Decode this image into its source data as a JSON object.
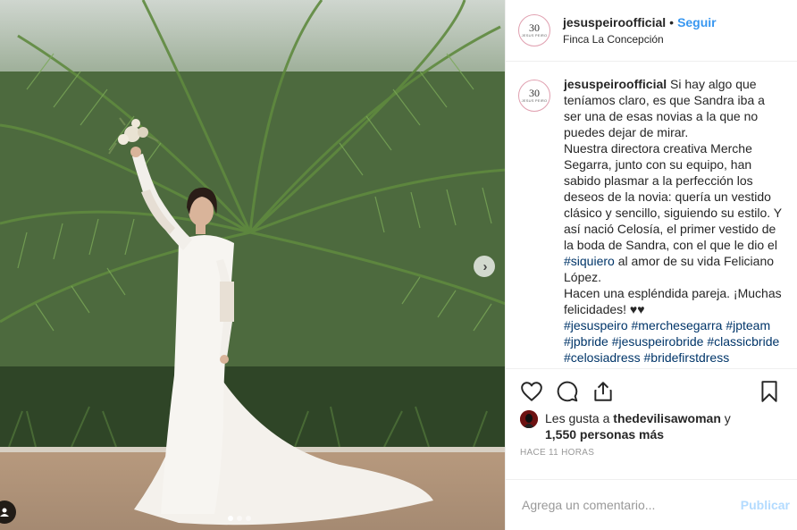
{
  "post": {
    "username": "jesuspeirooffical_placeholder",
    "follow_label": "Seguir",
    "location": "Finca La Concepción",
    "avatar_number": "30",
    "avatar_text": "JESUS PEIRO"
  },
  "caption": {
    "username": "jesuspeirooffical_placeholder",
    "text_1": "Si hay algo que teníamos claro, es que Sandra iba a ser una de esas novias a la que no puedes dejar de mirar.",
    "text_2": "Nuestra directora creativa Merche Segarra, junto con su equipo, han sabido plasmar a la perfección los deseos de la novia: quería un vestido clásico y sencillo, siguiendo su estilo. Y así nació Celosía, el primer vestido de la boda de Sandra, con el que le dio el",
    "hashtag_siquiero": "#siquiero",
    "text_3": "al amor de su vida Feliciano López.",
    "text_4": "Hacen una espléndida pareja. ¡Muchas felicidades! ♥♥",
    "hashtags": [
      "#jesuspeiro",
      "#merchesegarra",
      "#jpteam",
      "#jpbride",
      "#jesuspeirobride",
      "#classicbride",
      "#celosiadress",
      "#bridefirstdress"
    ]
  },
  "likes": {
    "prefix": "Les gusta a",
    "user": "thedevilisawoman",
    "joiner": "y",
    "count": "1,550 personas más"
  },
  "timestamp": "HACE 11 HORAS",
  "comment": {
    "placeholder": "Agrega un comentario...",
    "publish_label": "Publicar"
  },
  "colors": {
    "link_blue": "#3897f0",
    "hashtag": "#003569",
    "publish_disabled": "#b3dbff"
  },
  "carousel": {
    "current": 1,
    "total": 3
  }
}
